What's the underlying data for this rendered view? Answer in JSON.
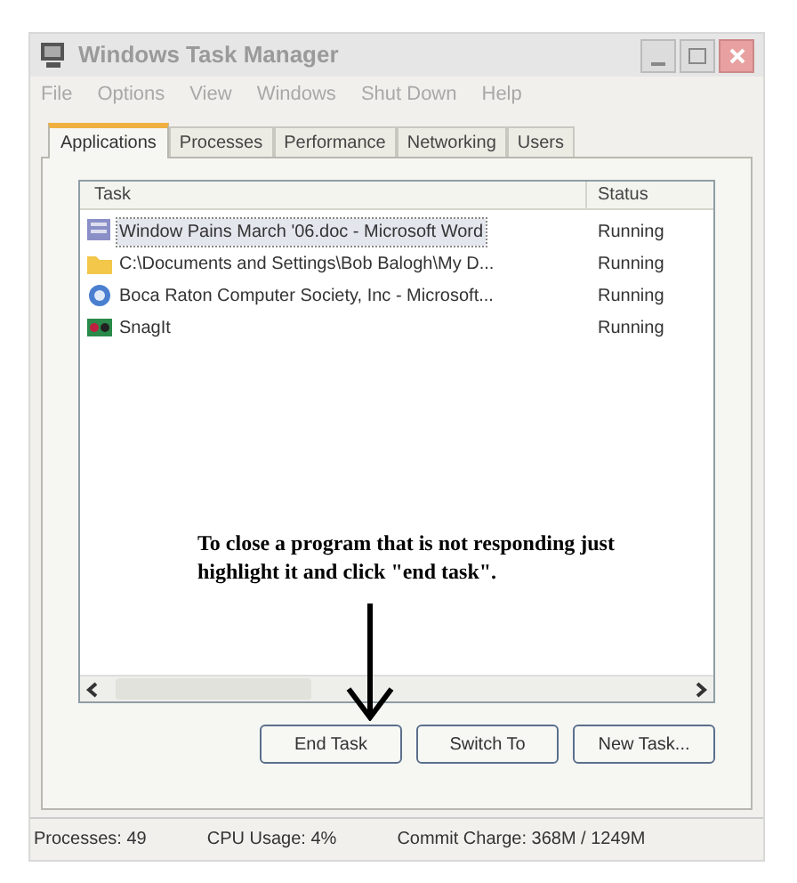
{
  "window": {
    "title": "Windows Task Manager"
  },
  "menu": [
    "File",
    "Options",
    "View",
    "Windows",
    "Shut Down",
    "Help"
  ],
  "tabs": [
    {
      "label": "Applications",
      "selected": true
    },
    {
      "label": "Processes",
      "selected": false
    },
    {
      "label": "Performance",
      "selected": false
    },
    {
      "label": "Networking",
      "selected": false
    },
    {
      "label": "Users",
      "selected": false
    }
  ],
  "table": {
    "columns": [
      "Task",
      "Status"
    ],
    "rows": [
      {
        "kind": "word",
        "task": "Window Pains March '06.doc - Microsoft Word",
        "status": "Running",
        "selected": true
      },
      {
        "kind": "folder",
        "task": "C:\\Documents and Settings\\Bob Balogh\\My D...",
        "status": "Running",
        "selected": false
      },
      {
        "kind": "browser",
        "task": "Boca Raton Computer Society, Inc - Microsoft...",
        "status": "Running",
        "selected": false
      },
      {
        "kind": "snagit",
        "task": "SnagIt",
        "status": "Running",
        "selected": false
      }
    ]
  },
  "annotation": "To close a program that is not responding just highlight it and click \"end task\".",
  "buttons": [
    "End Task",
    "Switch To",
    "New Task..."
  ],
  "status_bar": [
    "Processes: 49",
    "CPU Usage: 4%",
    "Commit Charge: 368M / 1249M"
  ]
}
